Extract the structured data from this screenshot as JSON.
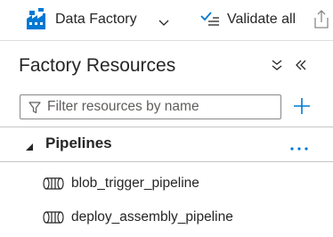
{
  "toolbar": {
    "factory_label": "Data Factory",
    "validate_label": "Validate all"
  },
  "panel": {
    "title": "Factory Resources"
  },
  "filter": {
    "placeholder": "Filter resources by name",
    "value": ""
  },
  "section": {
    "label": "Pipelines",
    "items": [
      {
        "label": "blob_trigger_pipeline"
      },
      {
        "label": "deploy_assembly_pipeline"
      }
    ]
  },
  "icons": {
    "factory": "factory-icon",
    "dropdown": "chevron-down-icon",
    "validate": "validate-checkmark-icon",
    "publish": "publish-upload-icon",
    "collapse_all": "collapse-all-icon",
    "collapse_panel": "double-chevron-left-icon",
    "filter": "filter-funnel-icon",
    "add": "plus-icon",
    "expand": "caret-expanded-icon",
    "more": "more-options-icon",
    "pipeline": "pipeline-icon"
  },
  "colors": {
    "accent": "#0078d4",
    "text": "#262626",
    "placeholder": "#605e5c",
    "border": "#8a8886"
  }
}
